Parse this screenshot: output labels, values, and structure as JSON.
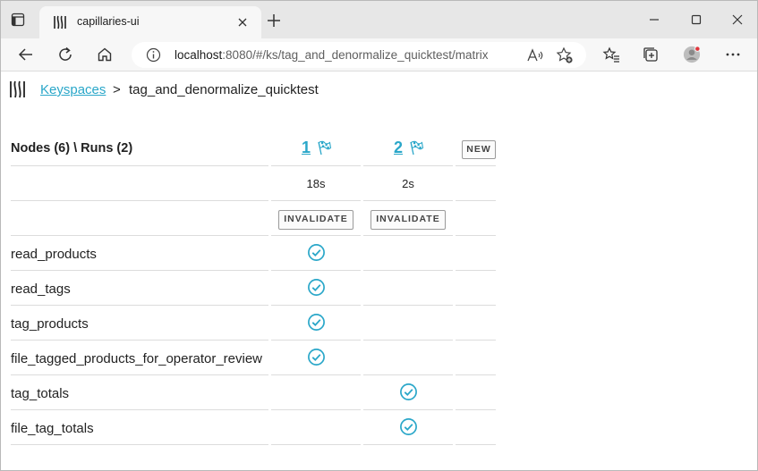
{
  "browser": {
    "tab_title": "capillaries-ui",
    "url_host": "localhost",
    "url_rest": ":8080/#/ks/tag_and_denormalize_quicktest/matrix"
  },
  "breadcrumb": {
    "link": "Keyspaces",
    "separator": ">",
    "current": "tag_and_denormalize_quicktest"
  },
  "matrix": {
    "header_label": "Nodes (6) \\ Runs (2)",
    "new_label": "NEW",
    "invalidate_label": "INVALIDATE",
    "runs": [
      {
        "id": "1",
        "duration": "18s"
      },
      {
        "id": "2",
        "duration": "2s"
      }
    ],
    "nodes": [
      {
        "name": "read_products",
        "run1": true,
        "run2": false
      },
      {
        "name": "read_tags",
        "run1": true,
        "run2": false
      },
      {
        "name": "tag_products",
        "run1": true,
        "run2": false
      },
      {
        "name": "file_tagged_products_for_operator_review",
        "run1": true,
        "run2": false
      },
      {
        "name": "tag_totals",
        "run1": false,
        "run2": true
      },
      {
        "name": "file_tag_totals",
        "run1": false,
        "run2": true
      }
    ]
  },
  "colors": {
    "accent": "#2aa7c9",
    "divider": "#dcdcdc"
  }
}
